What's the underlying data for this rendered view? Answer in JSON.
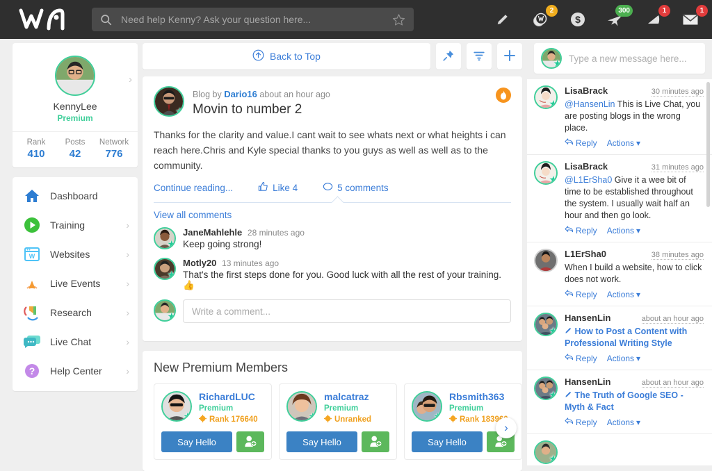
{
  "topbar": {
    "logo_name": "wa-logo",
    "search": {
      "placeholder": "Need help Kenny? Ask your question here...",
      "value": ""
    },
    "icons": [
      {
        "name": "pencil-icon",
        "badge": ""
      },
      {
        "name": "credits-icon",
        "badge": "2",
        "badge_color": "yellow"
      },
      {
        "name": "dollar-icon",
        "badge": ""
      },
      {
        "name": "airplane-icon",
        "badge": "300",
        "badge_color": "green"
      },
      {
        "name": "bell-icon",
        "badge": "1",
        "badge_color": "red"
      },
      {
        "name": "envelope-icon",
        "badge": "1",
        "badge_color": "red"
      }
    ]
  },
  "sidebar": {
    "profile": {
      "username": "KennyLee",
      "membership": "Premium",
      "stats": [
        {
          "label": "Rank",
          "value": "410"
        },
        {
          "label": "Posts",
          "value": "42"
        },
        {
          "label": "Network",
          "value": "776"
        }
      ]
    },
    "items": [
      {
        "label": "Dashboard",
        "icon": "home-icon",
        "chevron": false
      },
      {
        "label": "Training",
        "icon": "play-icon",
        "chevron": true
      },
      {
        "label": "Websites",
        "icon": "website-icon",
        "chevron": true
      },
      {
        "label": "Live Events",
        "icon": "broadcast-icon",
        "chevron": true
      },
      {
        "label": "Research",
        "icon": "research-icon",
        "chevron": true
      },
      {
        "label": "Live Chat",
        "icon": "chat-bubble-icon",
        "chevron": true
      },
      {
        "label": "Help Center",
        "icon": "question-icon",
        "chevron": true
      }
    ]
  },
  "main": {
    "toolbar": {
      "back_to_top": "Back to Top",
      "pin_label": "pin",
      "filter_label": "filter",
      "add_label": "add"
    },
    "post": {
      "meta_prefix": "Blog by",
      "author": "Dario16",
      "time": "about an hour ago",
      "title": "Movin to number 2",
      "body": "Thanks for the clarity and value.I cant wait to see whats next or what heights i can reach here.Chris and Kyle special thanks to you guys as well as well as to the community.",
      "continue_label": "Continue reading...",
      "like_label": "Like 4",
      "comments_label": "5 comments",
      "view_all_label": "View all comments",
      "comments": [
        {
          "name": "JaneMahlehle",
          "time": "28 minutes ago",
          "text": "Keep going strong!"
        },
        {
          "name": "Motly20",
          "time": "13 minutes ago",
          "text": "That's the first steps done for you. Good luck with all the rest of your training. 👍"
        }
      ],
      "comment_placeholder": "Write a comment..."
    },
    "members": {
      "title": "New Premium Members",
      "cards": [
        {
          "name": "RichardLUC",
          "membership": "Premium",
          "rank": "Rank 176640",
          "hello": "Say Hello",
          "add": "add-friend"
        },
        {
          "name": "malcatraz",
          "membership": "Premium",
          "rank": "Unranked",
          "hello": "Say Hello",
          "add": "add-friend"
        },
        {
          "name": "Rbsmith363",
          "membership": "Premium",
          "rank": "Rank 183960",
          "hello": "Say Hello",
          "add": "add-friend"
        }
      ],
      "next_label": "next"
    }
  },
  "chat": {
    "compose_placeholder": "Type a new message here...",
    "reply_label": "Reply",
    "actions_label": "Actions",
    "messages": [
      {
        "name": "LisaBrack",
        "time": "30 minutes ago",
        "mention": "@HansenLin",
        "text": " This is Live Chat, you are posting blogs in the wrong place.",
        "link": ""
      },
      {
        "name": "LisaBrack",
        "time": "31 minutes ago",
        "mention": "@L1ErSha0",
        "text": " Give it a wee bit of time to be established throughout the system. I usually wait half an hour and then go look.",
        "link": ""
      },
      {
        "name": "L1ErSha0",
        "time": "38 minutes ago",
        "mention": "",
        "text": "When I build a website, how to click does not work.",
        "link": ""
      },
      {
        "name": "HansenLin",
        "time": "about an hour ago",
        "mention": "",
        "text": "",
        "link": "How to Post a Content with Professional Writing Style"
      },
      {
        "name": "HansenLin",
        "time": "about an hour ago",
        "mention": "",
        "text": "",
        "link": "The Truth of Google SEO - Myth & Fact"
      }
    ]
  }
}
